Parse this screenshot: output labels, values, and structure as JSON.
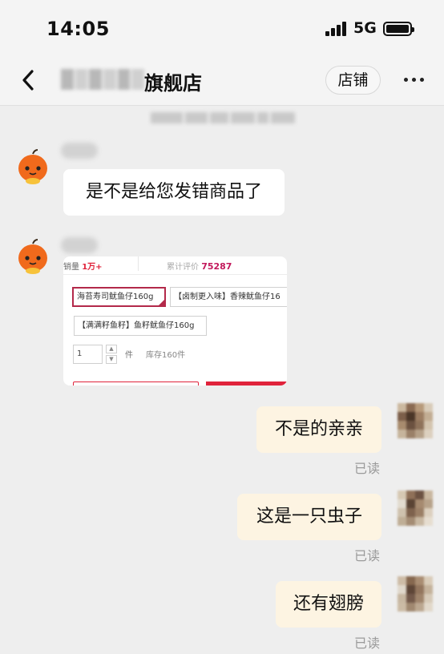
{
  "status_bar": {
    "time": "14:05",
    "network": "5G"
  },
  "header": {
    "title": "旗舰店",
    "shop_button": "店铺"
  },
  "messages": [
    {
      "side": "left",
      "type": "text",
      "text": "是不是给您发错商品了"
    },
    {
      "side": "left",
      "type": "product"
    },
    {
      "side": "right",
      "type": "text",
      "text": "不是的亲亲",
      "status": "已读"
    },
    {
      "side": "right",
      "type": "text",
      "text": "这是一只虫子",
      "status": "已读"
    },
    {
      "side": "right",
      "type": "text",
      "text": "还有翅膀",
      "status": "已读"
    }
  ],
  "product_card": {
    "sales_label": "销量",
    "sales_value": "1万+",
    "reviews_label": "累计评价",
    "reviews_value": "75287",
    "options": [
      "海苔寿司鱿鱼仔160g",
      "【卤制更入味】香辣鱿鱼仔16",
      "【满满籽鱼籽】鱼籽鱿鱼仔160g"
    ],
    "selected_option": "海苔寿司鱿鱼仔160g",
    "quantity": "1",
    "quantity_unit": "件",
    "stock": "库存160件"
  },
  "colors": {
    "accent_red": "#e0233b",
    "right_bubble": "#fdf4e2",
    "background": "#eeeeee"
  },
  "icons": [
    "back-chevron-icon",
    "more-icon",
    "mascot-avatar-icon",
    "signal-icon",
    "battery-icon"
  ]
}
